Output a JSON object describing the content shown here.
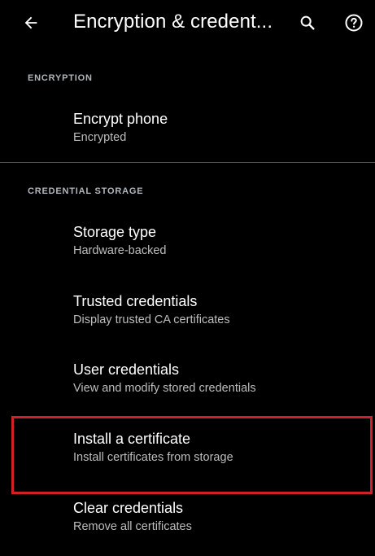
{
  "appbar": {
    "title": "Encryption & credent...",
    "icons": [
      "back-arrow-icon",
      "search-icon",
      "help-icon"
    ]
  },
  "sections": [
    {
      "header": "ENCRYPTION",
      "items": [
        {
          "title": "Encrypt phone",
          "subtitle": "Encrypted"
        }
      ]
    },
    {
      "header": "CREDENTIAL STORAGE",
      "items": [
        {
          "title": "Storage type",
          "subtitle": "Hardware-backed"
        },
        {
          "title": "Trusted credentials",
          "subtitle": "Display trusted CA certificates"
        },
        {
          "title": "User credentials",
          "subtitle": "View and modify stored credentials"
        },
        {
          "title": "Install a certificate",
          "subtitle": "Install certificates from storage"
        },
        {
          "title": "Clear credentials",
          "subtitle": "Remove all certificates"
        }
      ]
    }
  ],
  "colors": {
    "background": "#000000",
    "text_primary": "#ffffff",
    "text_secondary": "#bdbdbd",
    "highlight": "#d0202a"
  }
}
